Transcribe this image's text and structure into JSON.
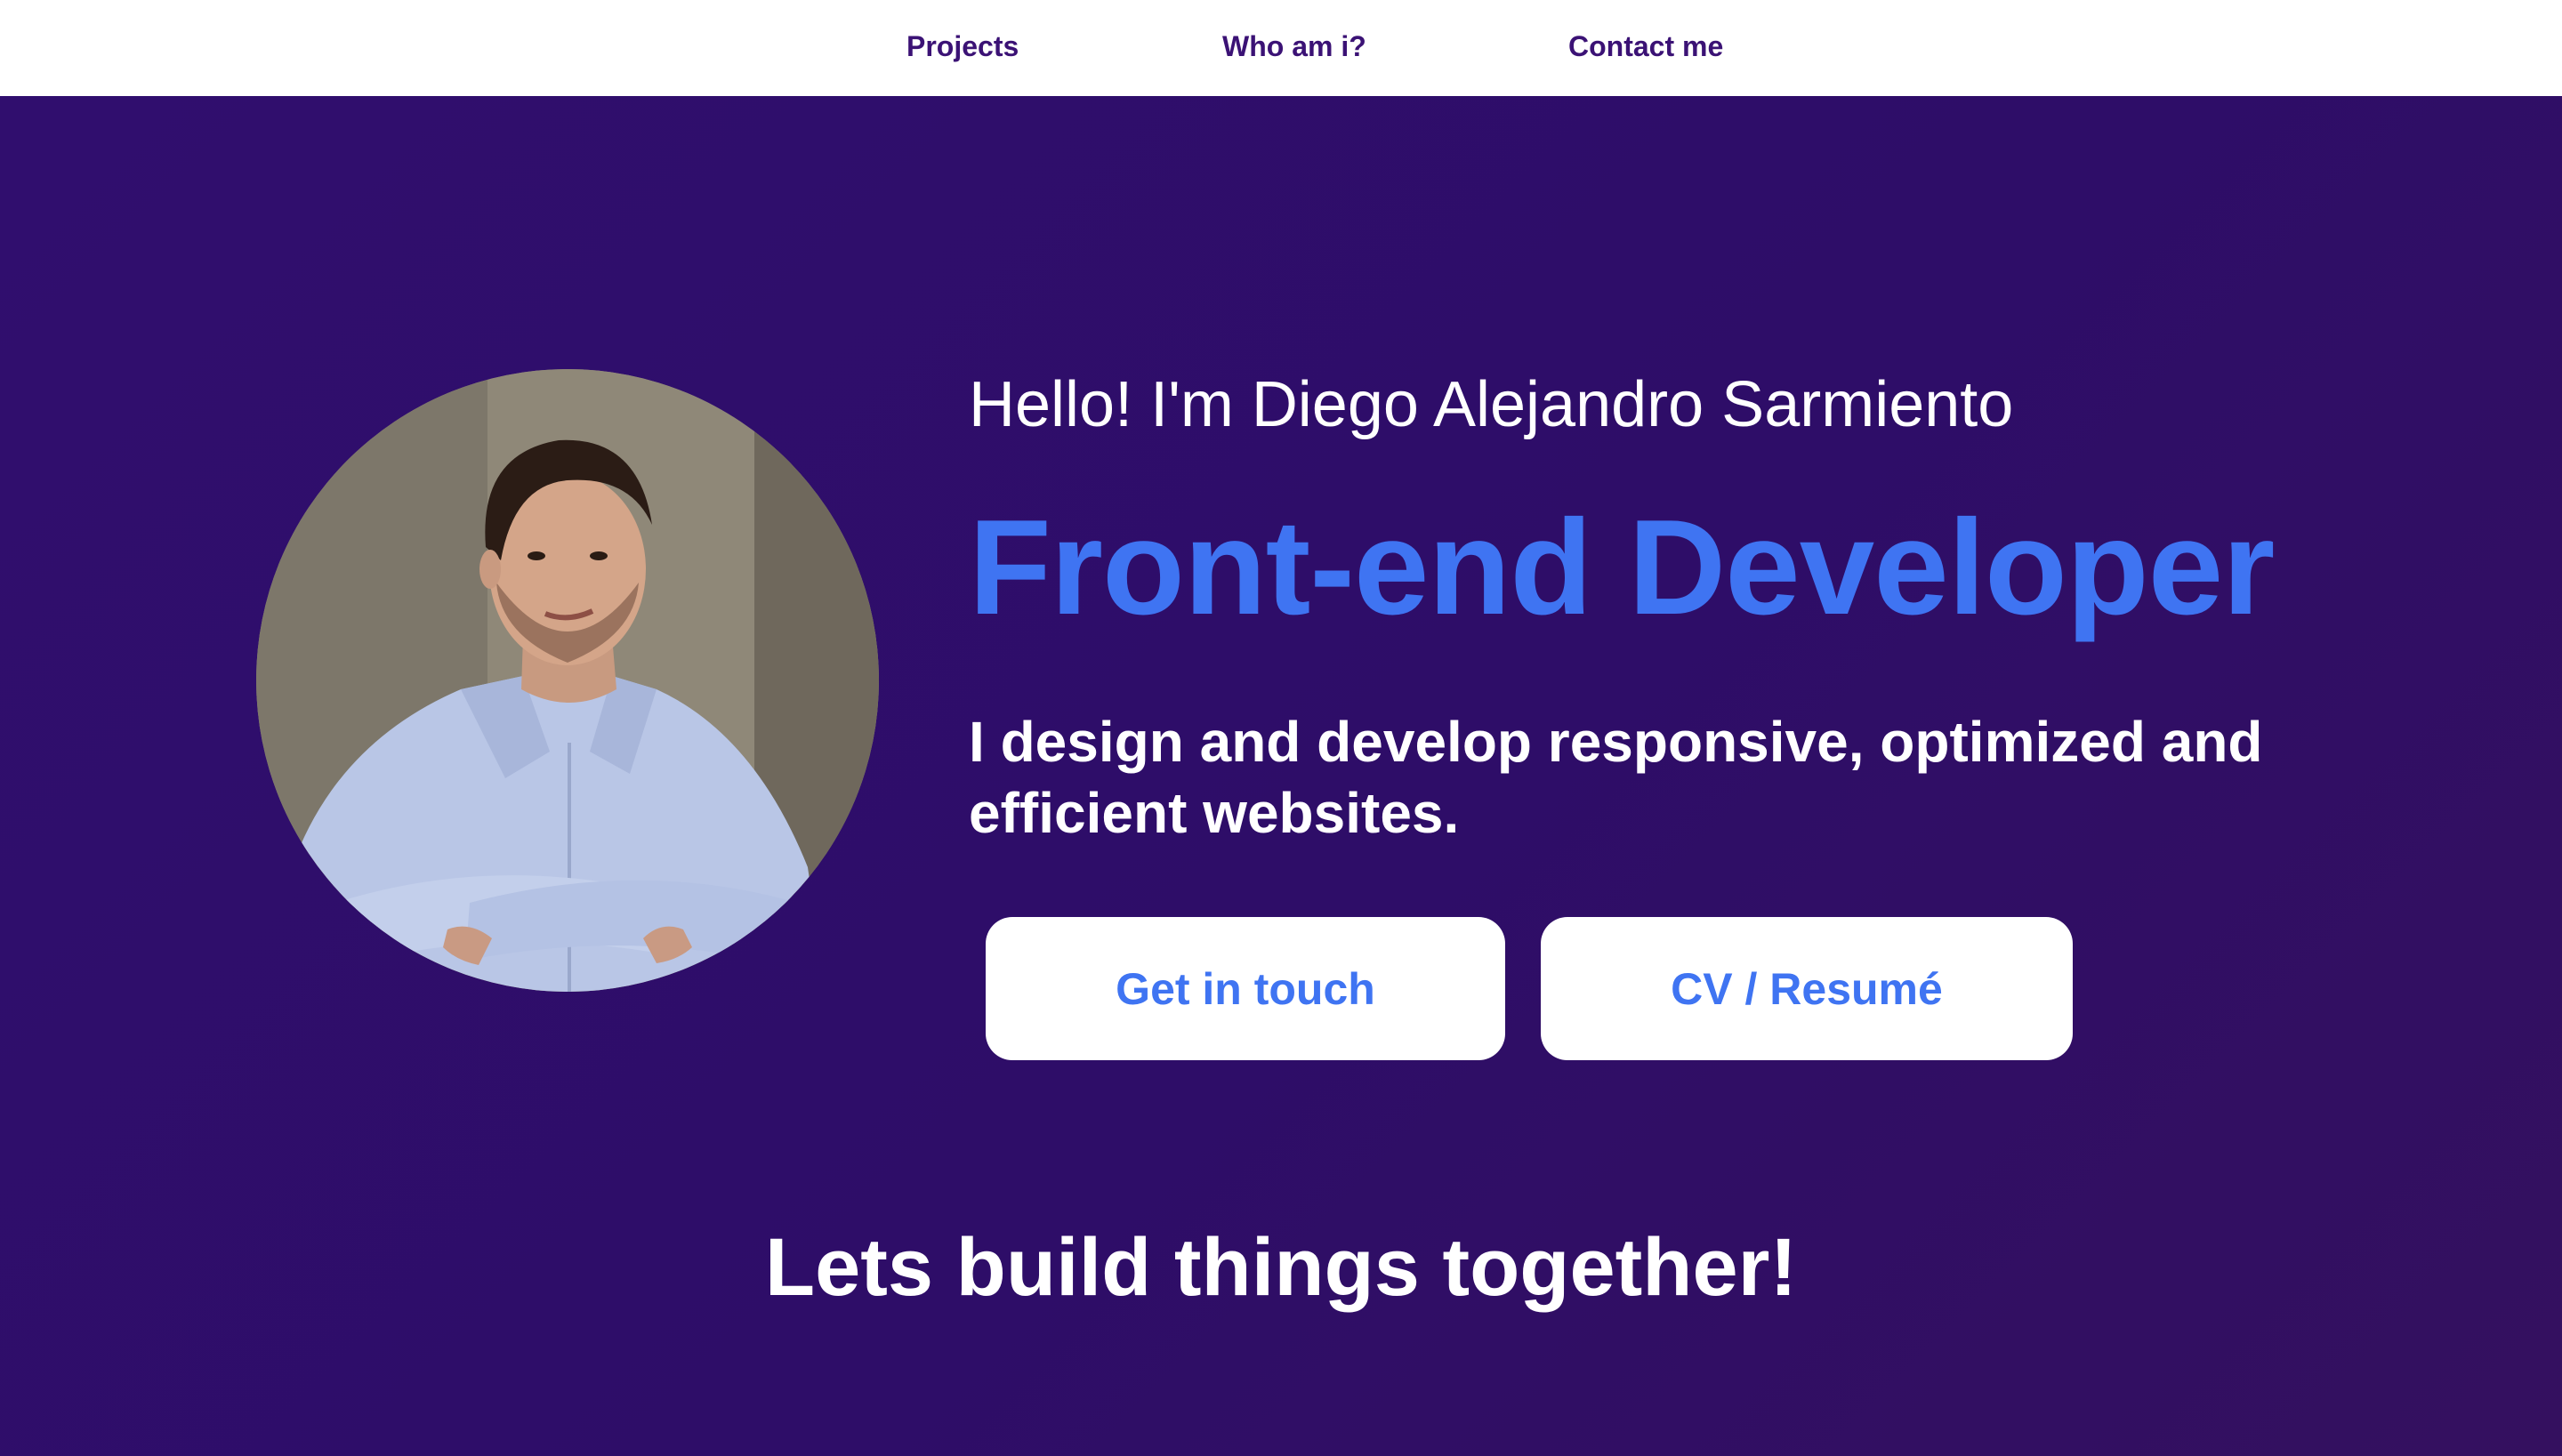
{
  "nav": {
    "items": [
      {
        "label": "Projects"
      },
      {
        "label": "Who am i?"
      },
      {
        "label": "Contact me"
      }
    ]
  },
  "hero": {
    "greeting": "Hello! I'm Diego Alejandro Sarmiento",
    "role": "Front-end Developer",
    "tagline": "I design and develop responsive, optimized and efficient websites.",
    "buttons": {
      "get_in_touch": "Get in touch",
      "cv": "CV / Resumé"
    },
    "closing": "Lets build things together!"
  },
  "colors": {
    "nav_text": "#3b1275",
    "background": "#2e0d68",
    "accent": "#3f74f2",
    "button_bg": "#ffffff"
  }
}
